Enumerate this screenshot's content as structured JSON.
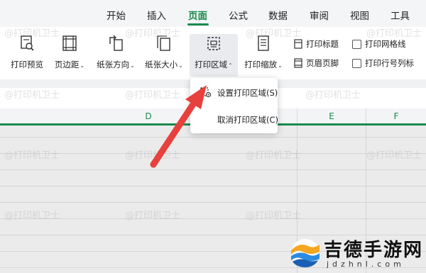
{
  "menu": {
    "tabs": [
      {
        "label": "开始"
      },
      {
        "label": "插入"
      },
      {
        "label": "页面"
      },
      {
        "label": "公式"
      },
      {
        "label": "数据"
      },
      {
        "label": "审阅"
      },
      {
        "label": "视图"
      },
      {
        "label": "工具"
      }
    ],
    "active_tab": "页面"
  },
  "ribbon": {
    "print_preview": "打印预览",
    "margins": "页边距",
    "orientation": "纸张方向",
    "paper_size": "纸张大小",
    "print_area": "打印区域",
    "print_scale": "打印缩放",
    "print_titles": "打印标题",
    "header_footer": "页眉页脚",
    "print_gridlines": "打印网格线",
    "print_row_col_headers": "打印行号列标"
  },
  "sheet": {
    "columns": [
      "D",
      "E",
      "F"
    ]
  },
  "dropdown": {
    "set_print_area": "设置打印区域(S)",
    "clear_print_area": "取消打印区域(C)"
  },
  "watermark": {
    "text": "@打印机卫士"
  },
  "logo": {
    "name": "吉德手游网",
    "domain": "jdzhnl.com"
  },
  "colors": {
    "accent": "#1a8a4c",
    "arrow": "#e8403c",
    "grid": "#ebebeb"
  }
}
